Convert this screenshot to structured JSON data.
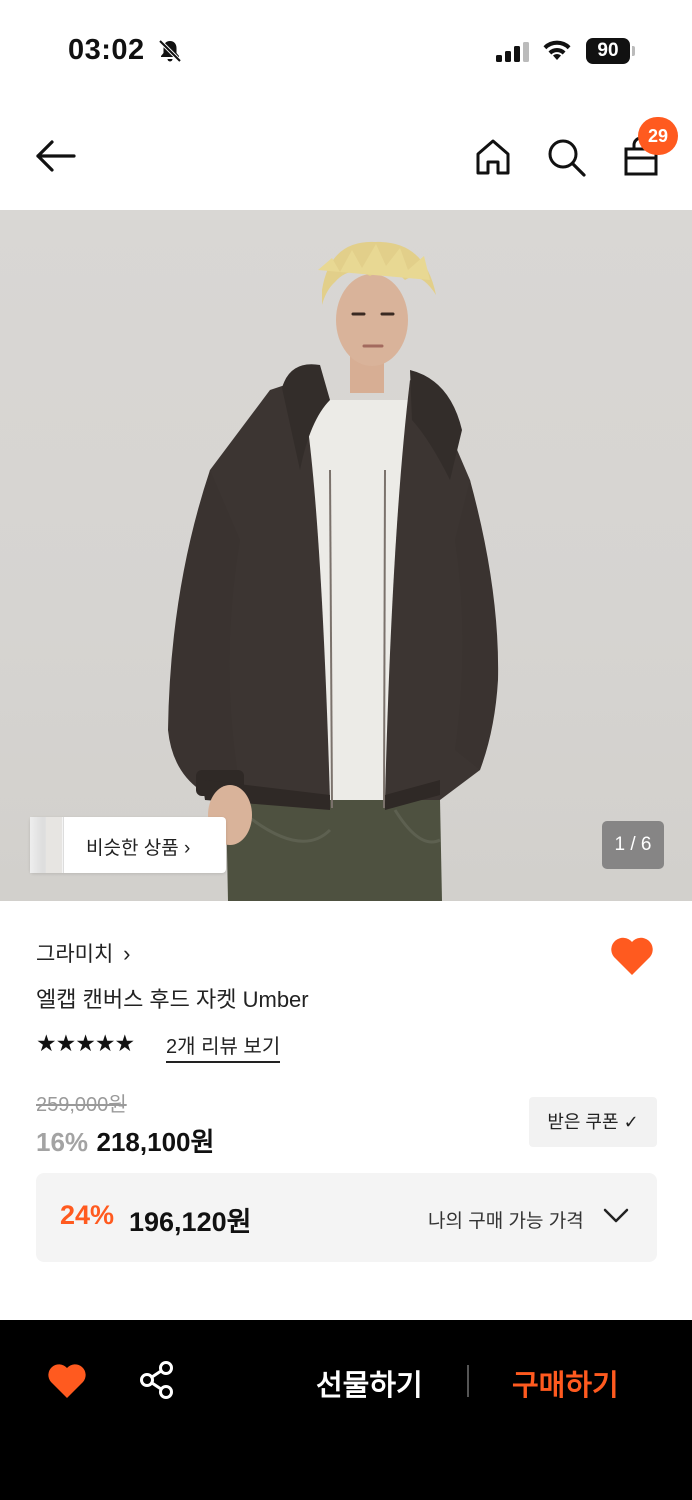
{
  "status_bar": {
    "time": "03:02",
    "battery": "90",
    "icons": [
      "bell-muted-icon",
      "signal-icon",
      "wifi-icon",
      "battery-icon"
    ]
  },
  "header": {
    "cart_count": "29",
    "icons": [
      "back-arrow-icon",
      "home-icon",
      "search-icon",
      "shopping-bag-icon"
    ]
  },
  "hero": {
    "similar_label": "비슷한 상품",
    "page_indicator": "1 / 6"
  },
  "product": {
    "brand": "그라미치",
    "name": "엘캡 캔버스 후드 자켓 Umber",
    "stars": "★★★★★",
    "rating": 5,
    "review_link": "2개 리뷰 보기",
    "original_price": "259,000원",
    "discount_pct": "16%",
    "sale_price": "218,100원",
    "coupon_label": "받은 쿠폰",
    "my_discount_pct": "24%",
    "my_price": "196,120원",
    "my_price_label": "나의 구매 가능 가격"
  },
  "bottom_bar": {
    "gift_label": "선물하기",
    "buy_label": "구매하기"
  },
  "colors": {
    "accent": "#ff5a1f",
    "bottom_bar_bg": "#000000",
    "price_box_bg": "#f4f4f4"
  }
}
